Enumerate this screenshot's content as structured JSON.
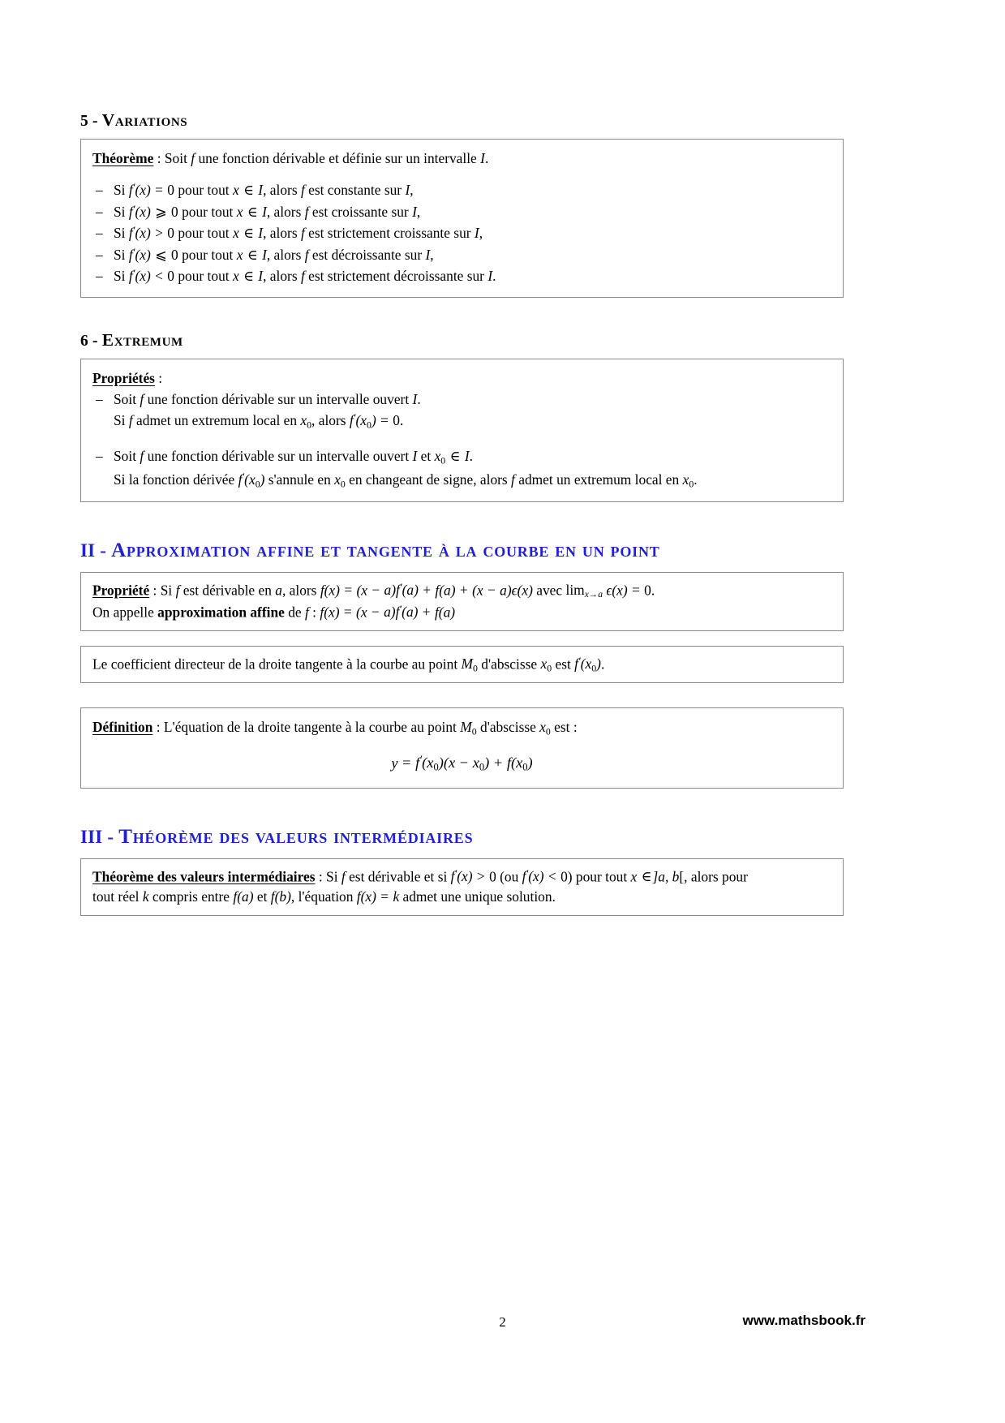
{
  "document": {
    "page_number": "2",
    "website": "www.mathsbook.fr",
    "heading_color": "#2020d8"
  },
  "sections": {
    "variations": {
      "number": "5 -",
      "title": "Variations",
      "box": {
        "term": "Théorème",
        "intro_after_term": " : Soit f une fonction dérivable et définie sur un intervalle I.",
        "items": [
          "Si f'(x) = 0 pour tout x ∈ I, alors f est constante sur I,",
          "Si f'(x) ⩾ 0 pour tout x ∈ I, alors f est croissante sur I,",
          "Si f'(x) > 0 pour tout x ∈ I, alors f est strictement croissante sur I,",
          "Si f'(x) ⩽ 0 pour tout x ∈ I, alors f est décroissante sur I,",
          "Si f'(x) < 0 pour tout x ∈ I, alors f est strictement décroissante sur I."
        ]
      }
    },
    "extremum": {
      "number": "6 -",
      "title": "Extremum",
      "box": {
        "term": "Propriétés",
        "term_suffix": " :",
        "item1_line1": "Soit f une fonction dérivable sur un intervalle ouvert I.",
        "item1_line2": "Si f admet un extremum local en x₀, alors f'(x₀) = 0.",
        "item2_line1": "Soit f une fonction dérivable sur un intervalle ouvert I et x₀ ∈ I.",
        "item2_line2": "Si la fonction dérivée f'(x₀) s'annule en x₀ en changeant de signe, alors f admet un extremum local en x₀."
      }
    },
    "approximation": {
      "number": "II -",
      "title": "Approximation affine et tangente à la courbe en un point",
      "box1": {
        "term": "Propriété",
        "line1": " : Si f est dérivable en a, alors f(x) = (x − a)f'(a) + f(a) + (x − a)ϵ(x) avec lim(x→a) ϵ(x) = 0.",
        "line2_prefix": "On appelle ",
        "line2_bold": "approximation affine",
        "line2_suffix": " de f : f(x) = (x − a)f'(a) + f(a)"
      },
      "box2": {
        "text": "Le coefficient directeur de la droite tangente à la courbe au point M₀ d'abscisse x₀ est f'(x₀)."
      },
      "box3": {
        "term": "Définition",
        "text": " : L'équation de la droite tangente à la courbe au point M₀ d'abscisse x₀ est :",
        "equation": "y = f'(x₀)(x − x₀) + f(x₀)"
      }
    },
    "tvi": {
      "number": "III -",
      "title": "Théorème des valeurs intermédiaires",
      "box": {
        "term": "Théorème des valeurs intermédiaires",
        "line1": " : Si f est dérivable et si f'(x) > 0 (ou f'(x) < 0) pour tout x ∈]a, b[, alors pour",
        "line2": "tout réel k compris entre f(a) et f(b), l'équation f(x) = k admet une unique solution."
      }
    }
  }
}
